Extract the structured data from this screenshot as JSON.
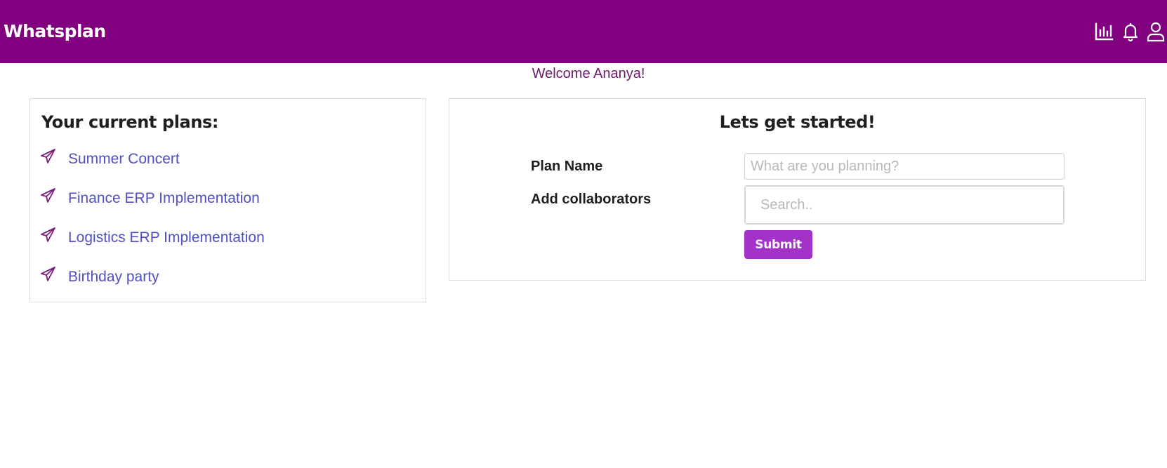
{
  "app": {
    "title": "Whatsplan"
  },
  "navbar": {
    "icons": [
      {
        "name": "bar-chart-icon",
        "label": "Reports"
      },
      {
        "name": "bell-icon",
        "label": "Notifications"
      },
      {
        "name": "user-icon",
        "label": "Profile"
      }
    ],
    "background_color": "#800080"
  },
  "welcome": {
    "text": "Welcome Ananya!"
  },
  "plans": {
    "title": "Your current plans:",
    "items": [
      {
        "label": "Summer Concert",
        "icon": "paper-plane-icon"
      },
      {
        "label": "Finance ERP Implementation",
        "icon": "paper-plane-icon"
      },
      {
        "label": "Logistics ERP Implementation",
        "icon": "paper-plane-icon"
      },
      {
        "label": "Birthday party",
        "icon": "paper-plane-icon"
      }
    ],
    "link_color": "#5050c0"
  },
  "start_form": {
    "title": "Lets get started!",
    "plan_name_label": "Plan Name",
    "plan_name_placeholder": "What are you planning?",
    "plan_name_value": "",
    "collaborators_label": "Add collaborators",
    "collaborators_placeholder": "Search..",
    "collaborators_value": "",
    "submit_label": "Submit",
    "submit_color": "#a333c8"
  }
}
